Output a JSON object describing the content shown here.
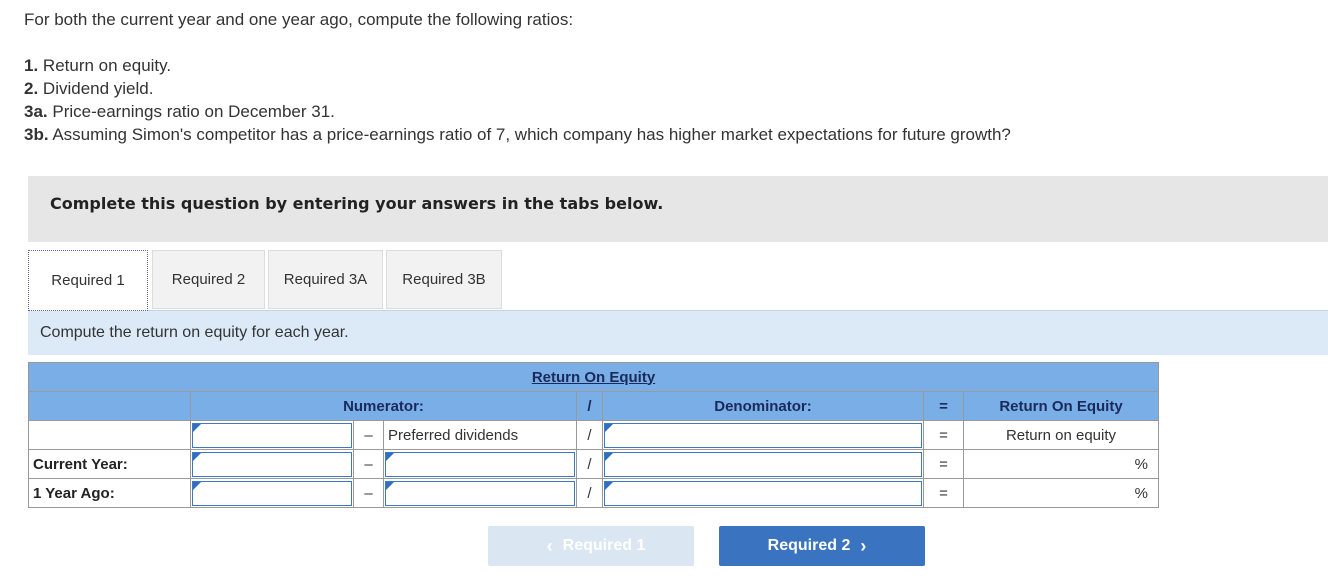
{
  "intro": {
    "line1": "For both the current year and one year ago, compute the following ratios:",
    "items": [
      {
        "num": "1.",
        "text": " Return on equity."
      },
      {
        "num": "2.",
        "text": " Dividend yield."
      },
      {
        "num": "3a.",
        "text": " Price-earnings ratio on December 31."
      },
      {
        "num": "3b.",
        "text": " Assuming Simon's competitor has a price-earnings ratio of 7, which company has higher market expectations for future growth?"
      }
    ]
  },
  "banner": "Complete this question by entering your answers in the tabs below.",
  "tabs": [
    "Required 1",
    "Required 2",
    "Required 3A",
    "Required 3B"
  ],
  "instruction": "Compute the return on equity for each year.",
  "table": {
    "title": "Return On Equity",
    "numerator": "Numerator:",
    "divide": "/",
    "denominator": "Denominator:",
    "equals": "=",
    "result_header": "Return On Equity",
    "minus": "–",
    "preferred": "Preferred dividends",
    "result_sub": "Return on equity",
    "rows": [
      {
        "label": "Current Year:",
        "unit": "%"
      },
      {
        "label": "1 Year Ago:",
        "unit": "%"
      }
    ]
  },
  "nav": {
    "prev": "Required 1",
    "next": "Required 2",
    "prev_icon": "‹",
    "next_icon": "›"
  }
}
